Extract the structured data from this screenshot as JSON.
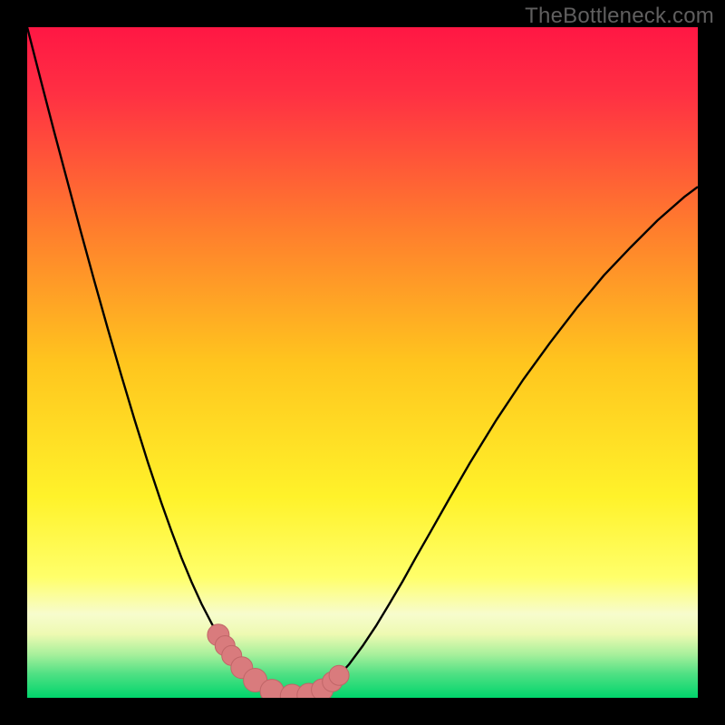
{
  "watermark": "TheBottleneck.com",
  "colors": {
    "frame_bg": "#000000",
    "grad_top": "#ff1f47",
    "grad_mid": "#ffd813",
    "grad_bot_yellow": "#ffff6a",
    "grad_pale": "#f6fccf",
    "grad_green_light": "#7eec8a",
    "grad_green": "#00d56c",
    "curve_stroke": "#000000",
    "marker_fill": "#d97b7d",
    "marker_stroke": "#c06668"
  },
  "chart_data": {
    "type": "line",
    "title": "",
    "xlabel": "",
    "ylabel": "",
    "x": [
      0.0,
      0.02,
      0.04,
      0.06,
      0.08,
      0.1,
      0.12,
      0.14,
      0.16,
      0.18,
      0.2,
      0.215,
      0.23,
      0.245,
      0.26,
      0.275,
      0.29,
      0.305,
      0.32,
      0.335,
      0.35,
      0.365,
      0.38,
      0.4,
      0.42,
      0.44,
      0.46,
      0.48,
      0.5,
      0.52,
      0.54,
      0.56,
      0.58,
      0.6,
      0.63,
      0.66,
      0.7,
      0.74,
      0.78,
      0.82,
      0.86,
      0.9,
      0.94,
      0.98,
      1.0
    ],
    "y_bottleneck": [
      1.0,
      0.922,
      0.845,
      0.77,
      0.695,
      0.622,
      0.551,
      0.482,
      0.415,
      0.351,
      0.291,
      0.249,
      0.209,
      0.173,
      0.14,
      0.111,
      0.085,
      0.063,
      0.045,
      0.03,
      0.019,
      0.01,
      0.005,
      0.002,
      0.004,
      0.012,
      0.028,
      0.05,
      0.077,
      0.107,
      0.14,
      0.174,
      0.21,
      0.245,
      0.298,
      0.35,
      0.415,
      0.475,
      0.53,
      0.582,
      0.63,
      0.672,
      0.712,
      0.747,
      0.762
    ],
    "xlim": [
      0,
      1
    ],
    "ylim": [
      0,
      1
    ],
    "markers": {
      "x": [
        0.285,
        0.295,
        0.305,
        0.32,
        0.34,
        0.365,
        0.395,
        0.42,
        0.44,
        0.455,
        0.465
      ],
      "r": [
        12,
        11,
        11,
        12,
        13,
        13,
        13,
        13,
        12,
        11,
        11
      ]
    },
    "gradient_stops": [
      {
        "offset": 0.0,
        "color": "#ff1744"
      },
      {
        "offset": 0.1,
        "color": "#ff3043"
      },
      {
        "offset": 0.3,
        "color": "#ff7d2d"
      },
      {
        "offset": 0.5,
        "color": "#ffc51e"
      },
      {
        "offset": 0.7,
        "color": "#fff22a"
      },
      {
        "offset": 0.82,
        "color": "#ffff6a"
      },
      {
        "offset": 0.875,
        "color": "#f7fccd"
      },
      {
        "offset": 0.905,
        "color": "#eefab2"
      },
      {
        "offset": 0.935,
        "color": "#a8f09c"
      },
      {
        "offset": 0.965,
        "color": "#4ee083"
      },
      {
        "offset": 1.0,
        "color": "#00d56c"
      }
    ]
  }
}
